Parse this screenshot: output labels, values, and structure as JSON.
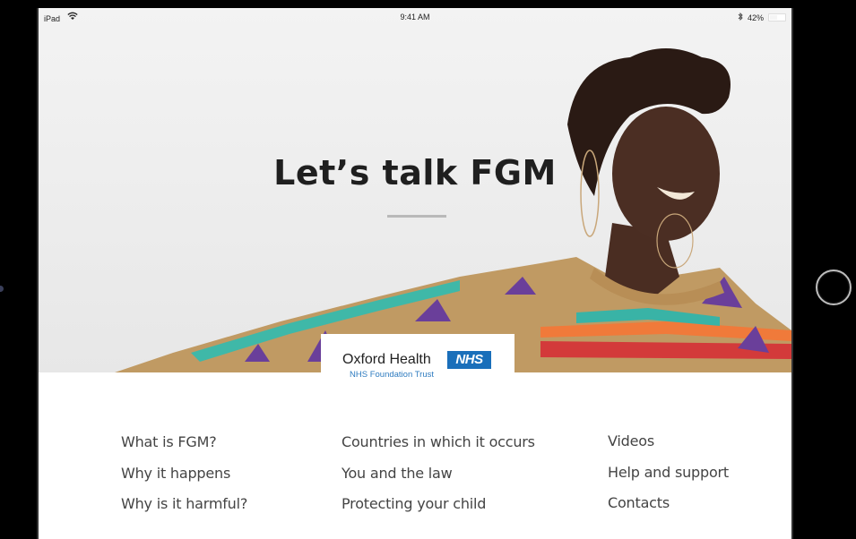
{
  "status_bar": {
    "carrier": "iPad",
    "wifi_icon": "wifi-icon",
    "time": "9:41 AM",
    "bluetooth_icon": "bluetooth-icon",
    "battery": "42%",
    "battery_level": 0.42
  },
  "hero": {
    "title": "Let’s talk FGM",
    "photo": "smiling-woman-patterned-sweater"
  },
  "logo": {
    "organization": "Oxford Health",
    "badge": "NHS",
    "subtitle": "NHS Foundation Trust",
    "badge_color": "#1a6fba"
  },
  "menu": {
    "columns": [
      {
        "items": [
          "What is FGM?",
          "Why it happens",
          "Why is it harmful?"
        ]
      },
      {
        "items": [
          "Countries in which it occurs",
          "You and the law",
          "Protecting your child"
        ]
      },
      {
        "items": [
          "Videos",
          "Help and support",
          "Contacts"
        ]
      }
    ]
  }
}
